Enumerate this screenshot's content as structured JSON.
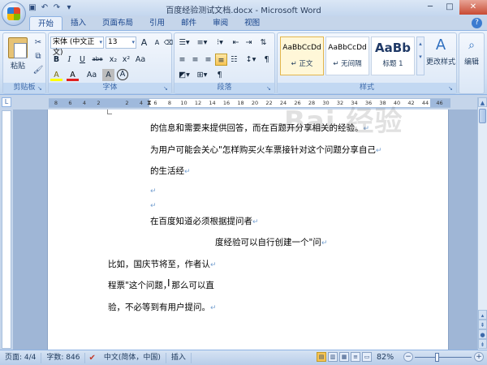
{
  "window": {
    "title": "百度经验测试文档.docx - Microsoft Word"
  },
  "tabs": [
    "开始",
    "插入",
    "页面布局",
    "引用",
    "邮件",
    "审阅",
    "视图"
  ],
  "ribbon": {
    "clipboard": {
      "paste": "粘贴",
      "label": "剪贴板"
    },
    "font": {
      "name": "宋体 (中文正文)",
      "size": "13",
      "label": "字体",
      "row2": [
        "B",
        "I",
        "U",
        "abe",
        "x₂",
        "x²",
        "Aa"
      ],
      "row3": [
        "A",
        "A",
        "Aa",
        "A",
        "A"
      ]
    },
    "paragraph": {
      "label": "段落"
    },
    "styles": {
      "label": "样式",
      "items": [
        {
          "sample": "AaBbCcDd",
          "name": "↵ 正文"
        },
        {
          "sample": "AaBbCcDd",
          "name": "↵ 无间隔"
        },
        {
          "sample": "AaBb",
          "name": "标题 1"
        }
      ],
      "change": "更改样式"
    },
    "editing": {
      "label": "编辑"
    }
  },
  "ruler": [
    "8",
    "6",
    "4",
    "2",
    "",
    "2",
    "4",
    "6",
    "8",
    "10",
    "12",
    "14",
    "16",
    "18",
    "20",
    "22",
    "24",
    "26",
    "28",
    "30",
    "32",
    "34",
    "36",
    "38",
    "40",
    "42",
    "44",
    "46"
  ],
  "document": {
    "lines": [
      "的信息和需要来提供回答，而在百题开分享相关的经验。",
      "为用户可能会关心\"怎样购买火车票接针对这个问题分享自己",
      "的生活经",
      "",
      "",
      "在百度知道必须根据提问者",
      "度经验可以自行创建一个\"问",
      "比如，国庆节将至，作者认",
      "程票\"这个问题，那么可以直",
      "验，不必等到有用户提问。"
    ]
  },
  "status": {
    "page": "页面: 4/4",
    "words": "字数: 846",
    "language": "中文(简体，中国)",
    "mode": "插入",
    "zoom": "82%",
    "zoom_fraction": 0.82
  },
  "watermark": "Bai 经验",
  "colors": {
    "accent": "#2f6fbf",
    "highlight": "#f7c453"
  }
}
